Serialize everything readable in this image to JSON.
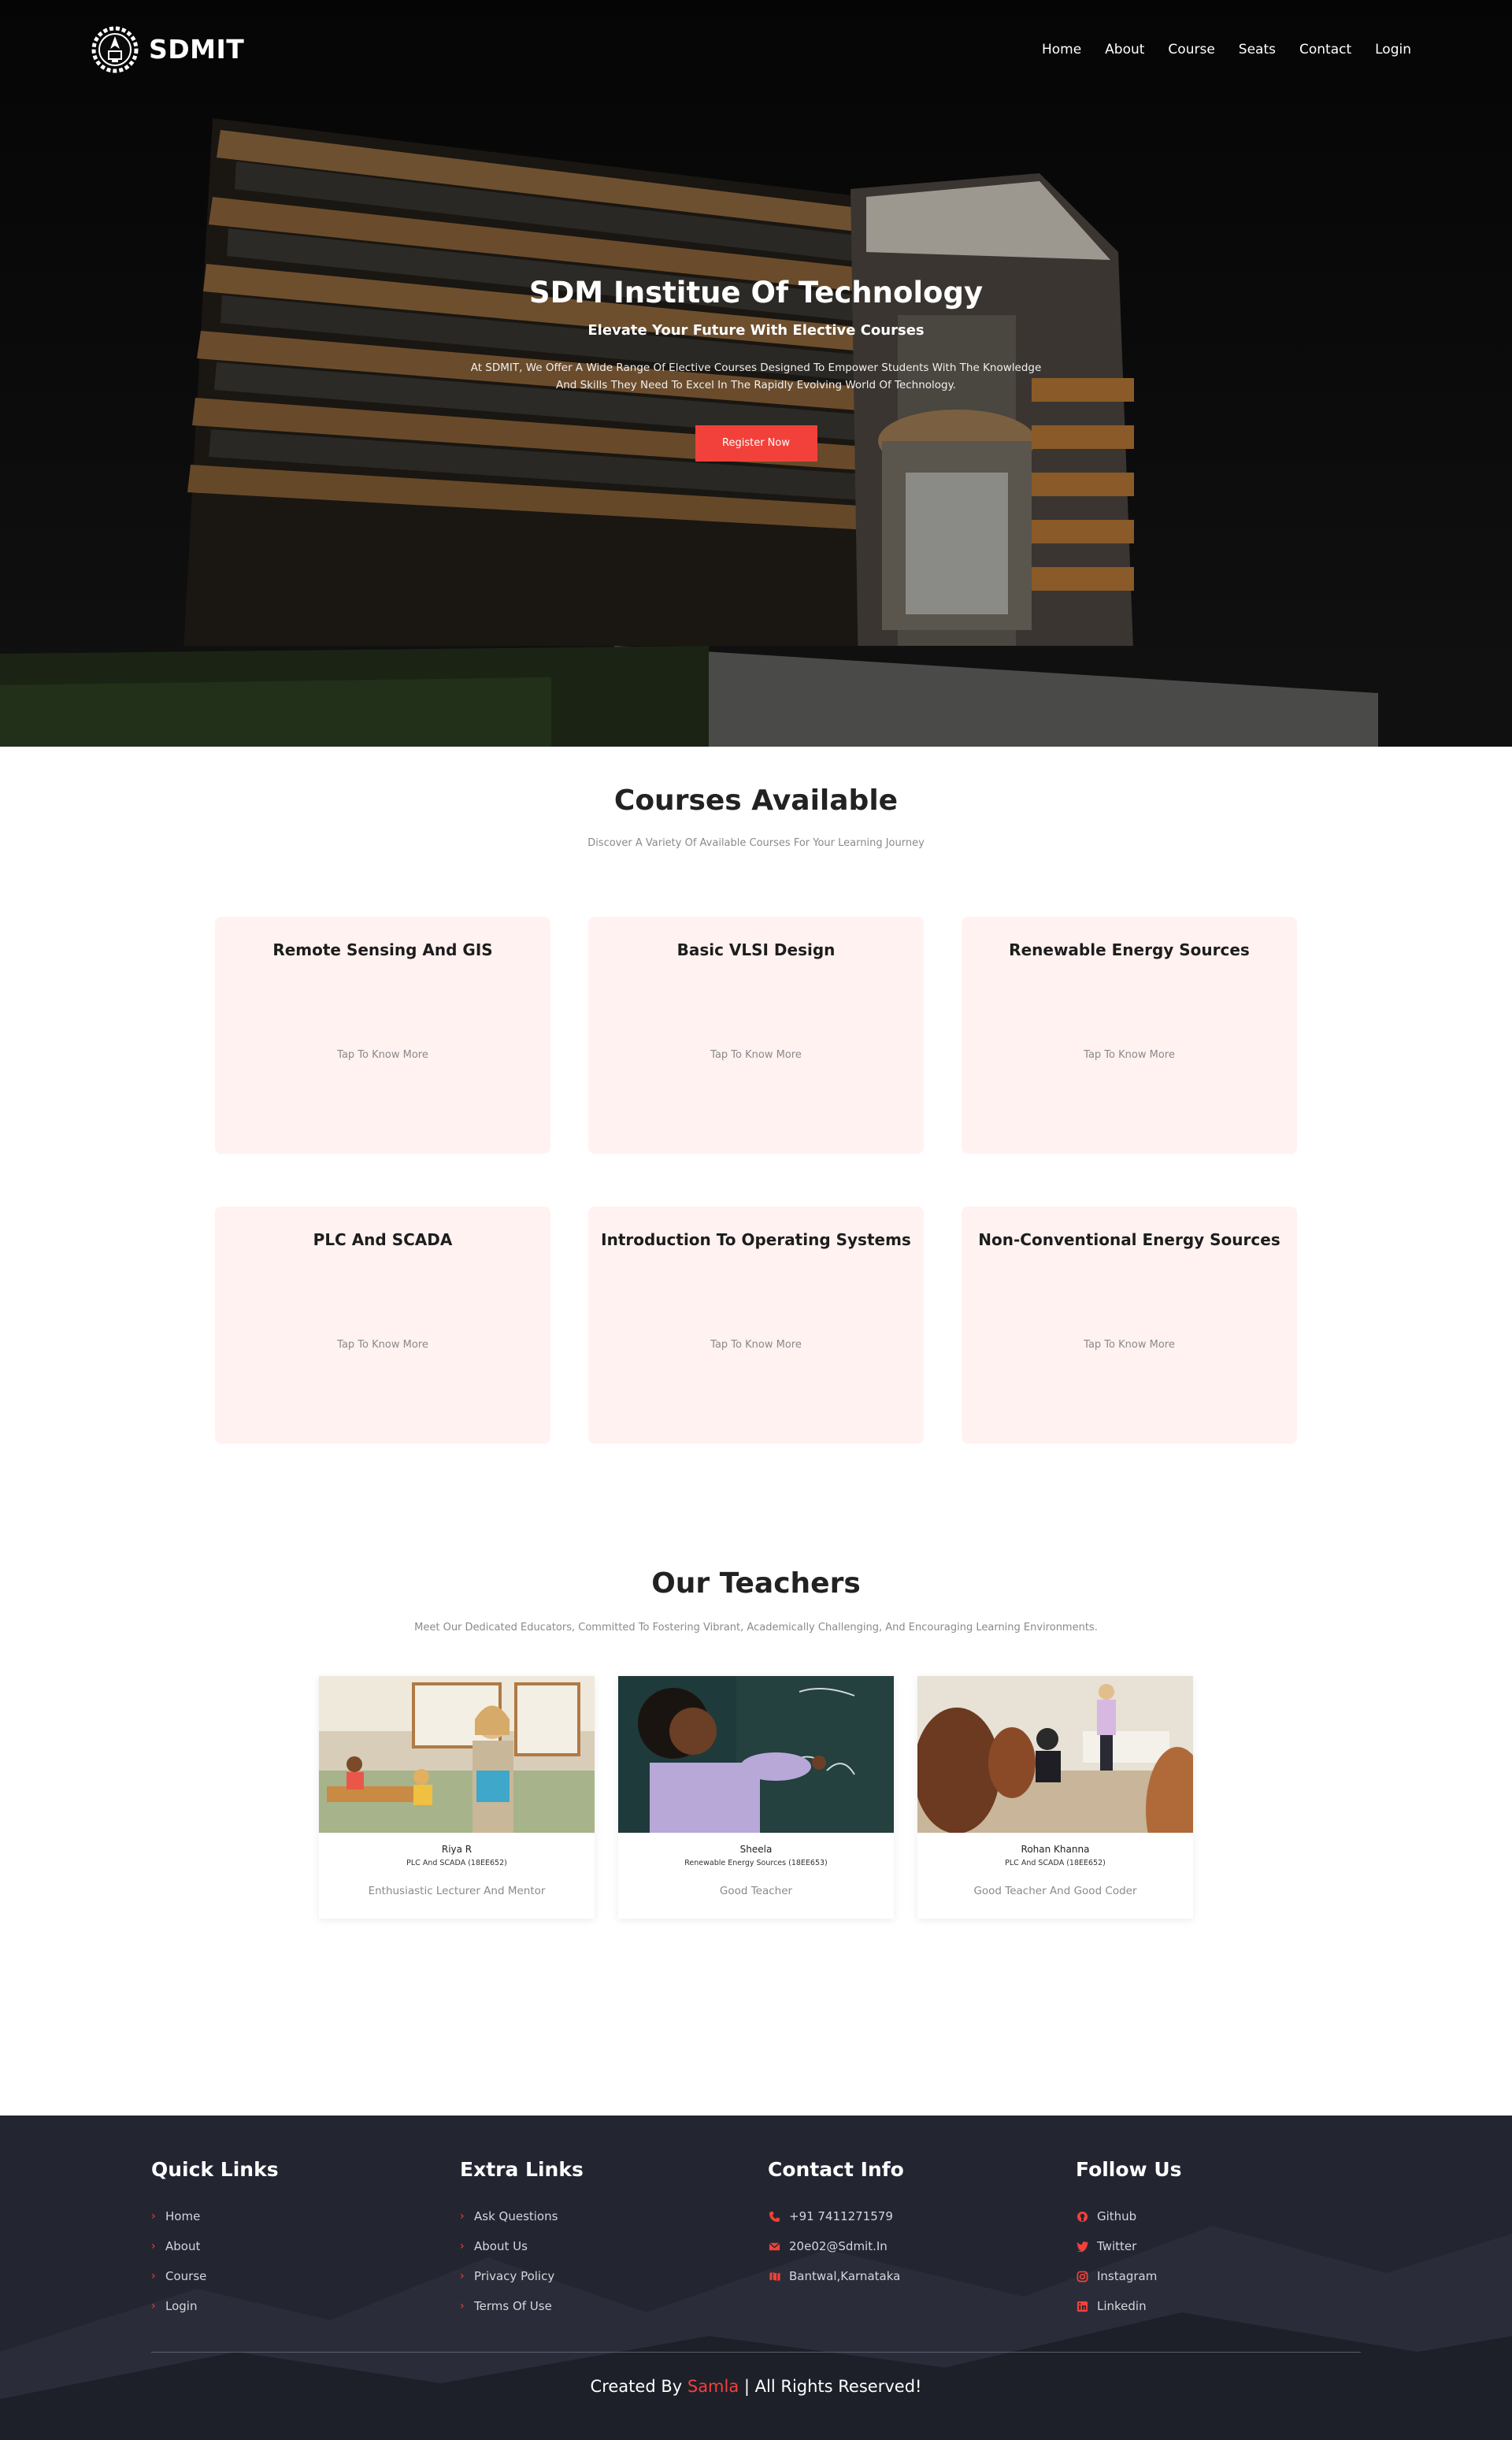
{
  "brand": {
    "name": "SDMIT"
  },
  "nav": {
    "items": [
      "Home",
      "About",
      "Course",
      "Seats",
      "Contact",
      "Login"
    ]
  },
  "hero": {
    "title": "SDM Institue Of Technology",
    "subtitle": "Elevate Your Future With Elective Courses",
    "description_line1": "At SDMIT, We Offer A Wide Range Of Elective Courses Designed To Empower Students With The Knowledge",
    "description_line2": "And Skills They Need To Excel In The Rapidly Evolving World Of Technology.",
    "cta": "Register Now"
  },
  "courses": {
    "title": "Courses Available",
    "subtitle": "Discover A Variety Of Available Courses For Your Learning Journey",
    "more_label": "Tap To Know More",
    "items": [
      "Remote Sensing And GIS",
      "Basic VLSI Design",
      "Renewable Energy Sources",
      "PLC And SCADA",
      "Introduction To Operating Systems",
      "Non-Conventional Energy Sources"
    ]
  },
  "teachers": {
    "title": "Our Teachers",
    "subtitle": "Meet Our Dedicated Educators, Committed To Fostering Vibrant, Academically Challenging, And Encouraging Learning Environments.",
    "items": [
      {
        "name": "Riya R",
        "course": "PLC And SCADA (18EE652)",
        "desc": "Enthusiastic Lecturer And Mentor"
      },
      {
        "name": "Sheela",
        "course": "Renewable Energy Sources (18EE653)",
        "desc": "Good Teacher"
      },
      {
        "name": "Rohan Khanna",
        "course": "PLC And SCADA (18EE652)",
        "desc": "Good Teacher And Good Coder"
      }
    ]
  },
  "footer": {
    "quick_links": {
      "title": "Quick Links",
      "items": [
        "Home",
        "About",
        "Course",
        "Login"
      ]
    },
    "extra_links": {
      "title": "Extra Links",
      "items": [
        "Ask Questions",
        "About Us",
        "Privacy Policy",
        "Terms Of Use"
      ]
    },
    "contact": {
      "title": "Contact Info",
      "phone": "+91 7411271579",
      "email": "20e02@Sdmit.In",
      "address": "Bantwal,Karnataka"
    },
    "follow": {
      "title": "Follow Us",
      "items": [
        "Github",
        "Twitter",
        "Instagram",
        "Linkedin"
      ]
    },
    "credit_prefix": "Created By",
    "credit_name": "Samla",
    "credit_suffix": "| All Rights Reserved!"
  },
  "colors": {
    "accent": "#f2413a",
    "card_bg": "#fff2f1",
    "footer_bg": "#232631"
  },
  "icons": {
    "brand": "gear-emblem-icon",
    "chevron": "chevron-right-icon",
    "contact": [
      "phone-icon",
      "envelope-icon",
      "map-icon"
    ],
    "follow": [
      "github-icon",
      "twitter-icon",
      "instagram-icon",
      "linkedin-icon"
    ]
  }
}
